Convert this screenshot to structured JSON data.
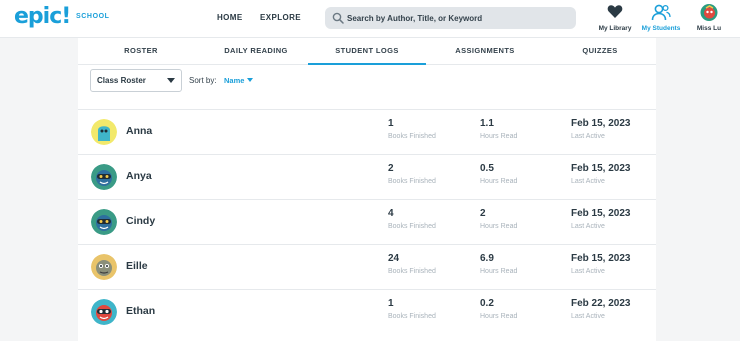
{
  "header": {
    "logo": "epic!",
    "logo_sub": "SCHOOL",
    "nav": [
      {
        "label": "HOME"
      },
      {
        "label": "EXPLORE"
      }
    ],
    "search_placeholder": "Search by Author, Title, or Keyword",
    "icons": [
      {
        "label": "My Library",
        "icon": "heart-icon"
      },
      {
        "label": "My Students",
        "icon": "students-icon"
      },
      {
        "label": "Miss Lu",
        "icon": "avatar"
      }
    ]
  },
  "tabs": [
    {
      "label": "ROSTER",
      "active": false
    },
    {
      "label": "DAILY READING",
      "active": false
    },
    {
      "label": "STUDENT LOGS",
      "active": true
    },
    {
      "label": "ASSIGNMENTS",
      "active": false
    },
    {
      "label": "QUIZZES",
      "active": false
    }
  ],
  "controls": {
    "class_select": "Class Roster",
    "sort_label": "Sort by:",
    "sort_value": "Name"
  },
  "students": [
    {
      "name": "Anna",
      "books": "1",
      "books_label": "Books Finished",
      "hours": "1.1",
      "hours_label": "Hours Read",
      "date": "Feb 15, 2023",
      "date_label": "Last Active"
    },
    {
      "name": "Anya",
      "books": "2",
      "books_label": "Books Finished",
      "hours": "0.5",
      "hours_label": "Hours Read",
      "date": "Feb 15, 2023",
      "date_label": "Last Active"
    },
    {
      "name": "Cindy",
      "books": "4",
      "books_label": "Books Finished",
      "hours": "2",
      "hours_label": "Hours Read",
      "date": "Feb 15, 2023",
      "date_label": "Last Active"
    },
    {
      "name": "Eille",
      "books": "24",
      "books_label": "Books Finished",
      "hours": "6.9",
      "hours_label": "Hours Read",
      "date": "Feb 15, 2023",
      "date_label": "Last Active"
    },
    {
      "name": "Ethan",
      "books": "1",
      "books_label": "Books Finished",
      "hours": "0.2",
      "hours_label": "Hours Read",
      "date": "Feb 22, 2023",
      "date_label": "Last Active"
    }
  ],
  "colors": {
    "accent": "#1a9fd9",
    "text": "#2b3a44",
    "muted": "#a9b3bb"
  }
}
